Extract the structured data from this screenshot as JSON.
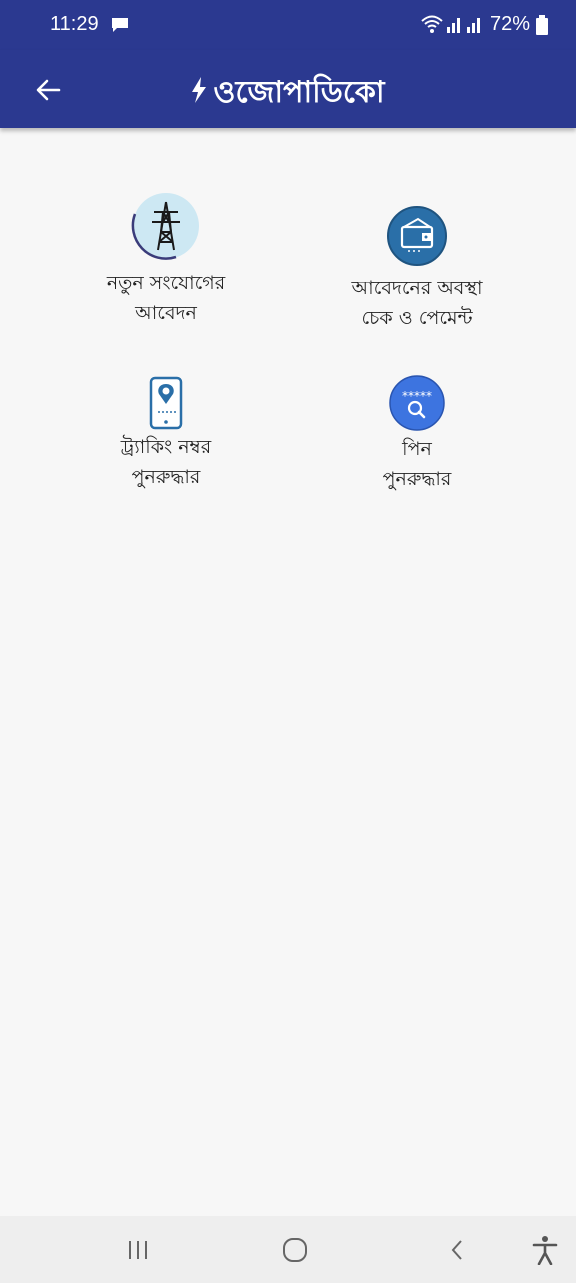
{
  "status_bar": {
    "time": "11:29",
    "battery": "72%"
  },
  "app_bar": {
    "title": "ওজোপাডিকো"
  },
  "tiles": [
    {
      "line1": "নতুন সংযোগের",
      "line2": "আবেদন",
      "icon": "transmission-tower-icon"
    },
    {
      "line1": "আবেদনের অবস্থা",
      "line2": "চেক ও পেমেন্ট",
      "icon": "wallet-icon"
    },
    {
      "line1": "ট্র্যাকিং নম্বর",
      "line2": "পুনরুদ্ধার",
      "icon": "phone-location-icon"
    },
    {
      "line1": "পিন",
      "line2": "পুনরুদ্ধার",
      "icon": "pin-search-icon"
    }
  ],
  "colors": {
    "primary": "#2b3990",
    "status_icon_bg": "#2a6fa8",
    "pin_icon_bg": "#3d74e0",
    "tower_icon_bg": "#cde8f3"
  }
}
